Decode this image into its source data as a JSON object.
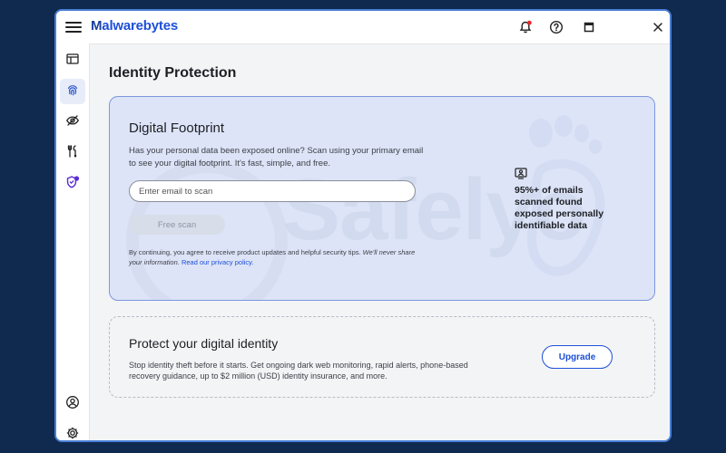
{
  "app": {
    "brand": "Malwarebytes",
    "accent_color": "#1d4fd8"
  },
  "titlebar": {
    "icons": [
      "menu-icon",
      "notification-bell-icon",
      "help-icon",
      "maximize-icon",
      "close-icon"
    ]
  },
  "sidebar": {
    "items": [
      {
        "icon": "dashboard-icon"
      },
      {
        "icon": "fingerprint-icon",
        "active": true
      },
      {
        "icon": "privacy-eye-icon"
      },
      {
        "icon": "tools-icon"
      },
      {
        "icon": "shield-alert-icon"
      },
      {
        "icon": "account-icon"
      },
      {
        "icon": "settings-gear-icon"
      }
    ]
  },
  "page": {
    "title": "Identity Protection"
  },
  "footprint": {
    "title": "Digital Footprint",
    "description": "Has your personal data been exposed online? Scan using your primary email to see your digital footprint. It's fast, simple, and free.",
    "email_placeholder": "Enter email to scan",
    "scan_button": "Free scan",
    "legal_text": "By continuing, you agree to receive product updates and helpful security tips.",
    "legal_italic": "We'll never share your information.",
    "privacy_link": "Read our privacy policy.",
    "stat": "95%+ of emails scanned found exposed personally identifiable data"
  },
  "protect": {
    "title": "Protect your digital identity",
    "description": "Stop identity theft before it starts. Get ongoing dark web monitoring, rapid alerts, phone-based recovery guidance, up to $2 million (USD) identity insurance, and more.",
    "upgrade_button": "Upgrade"
  },
  "watermark": {
    "text": "Safelyo"
  }
}
